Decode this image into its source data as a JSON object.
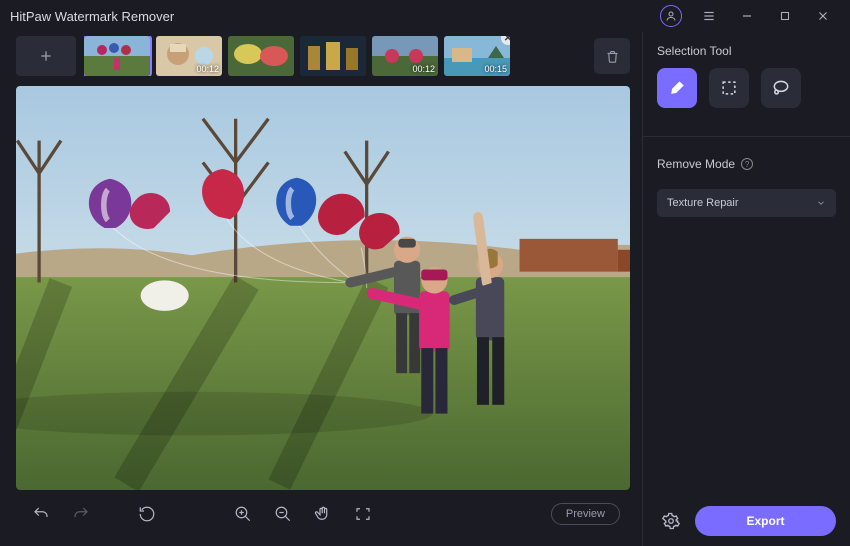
{
  "app": {
    "title": "HitPaw Watermark Remover"
  },
  "titlebar_icons": {
    "profile": "profile-icon",
    "menu": "hamburger-icon",
    "minimize": "minimize-icon",
    "maximize": "maximize-icon",
    "close": "close-icon"
  },
  "thumbnails": [
    {
      "duration": "",
      "selected": true
    },
    {
      "duration": "00:12"
    },
    {
      "duration": ""
    },
    {
      "duration": ""
    },
    {
      "duration": "00:12"
    },
    {
      "duration": "00:15",
      "closable": true
    }
  ],
  "toolbar": {
    "undo": "undo-icon",
    "redo": "redo-icon",
    "reset": "reset-icon",
    "zoom_in": "zoom-in-icon",
    "zoom_out": "zoom-out-icon",
    "pan": "pan-hand-icon",
    "fit": "fit-screen-icon",
    "preview_label": "Preview"
  },
  "sidebar": {
    "selection_label": "Selection Tool",
    "tools": [
      {
        "name": "brush-tool",
        "active": true
      },
      {
        "name": "marquee-tool",
        "active": false
      },
      {
        "name": "lasso-tool",
        "active": false
      }
    ],
    "remove_mode_label": "Remove Mode",
    "remove_mode_value": "Texture Repair",
    "settings_icon": "gear-icon",
    "export_label": "Export"
  },
  "colors": {
    "accent": "#7a6cff",
    "bg": "#1a1b23",
    "panel": "#2a2c38"
  }
}
